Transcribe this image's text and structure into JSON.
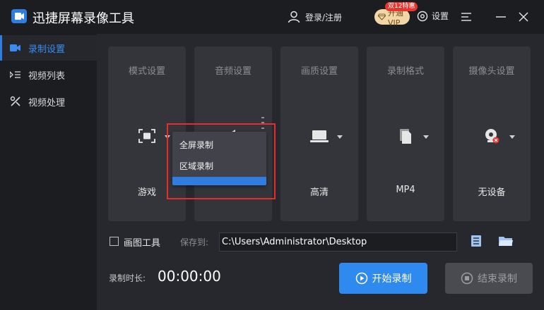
{
  "app": {
    "title": "迅捷屏幕录像工具"
  },
  "header": {
    "user_label": "登录/注册",
    "vip_label": "开通VIP",
    "vip_badge": "双12特惠",
    "settings_label": "设置"
  },
  "sidebar": {
    "items": [
      {
        "label": "录制设置",
        "icon": "video-camera-icon",
        "active": true
      },
      {
        "label": "视频列表",
        "icon": "list-icon",
        "active": false
      },
      {
        "label": "视频处理",
        "icon": "tools-icon",
        "active": false
      }
    ]
  },
  "cards": [
    {
      "title": "模式设置",
      "value": "游戏",
      "icon": "fullscreen-icon"
    },
    {
      "title": "音频设置",
      "value": "",
      "icon": "speaker-icon"
    },
    {
      "title": "画质设置",
      "value": "高清",
      "icon": "laptop-icon"
    },
    {
      "title": "录制格式",
      "value": "MP4",
      "icon": "file-icon"
    },
    {
      "title": "摄像头设置",
      "value": "无设备",
      "icon": "webcam-disabled-icon"
    }
  ],
  "mode_dropdown": {
    "options": [
      "全屏录制",
      "区域录制"
    ],
    "hovered_index": 1
  },
  "bottom": {
    "checkbox_label": "画图工具",
    "checkbox_checked": false,
    "save_to_label": "保存到:",
    "save_path": "C:\\Users\\Administrator\\Desktop",
    "duration_label": "录制时长:",
    "duration_value": "00:00:00",
    "start_label": "开始录制",
    "stop_label": "结束录制"
  },
  "colors": {
    "accent": "#2f7de1",
    "highlight_border": "#e82c2c",
    "vip_gold": "#f1d7a8",
    "badge_red": "#e8342d"
  }
}
